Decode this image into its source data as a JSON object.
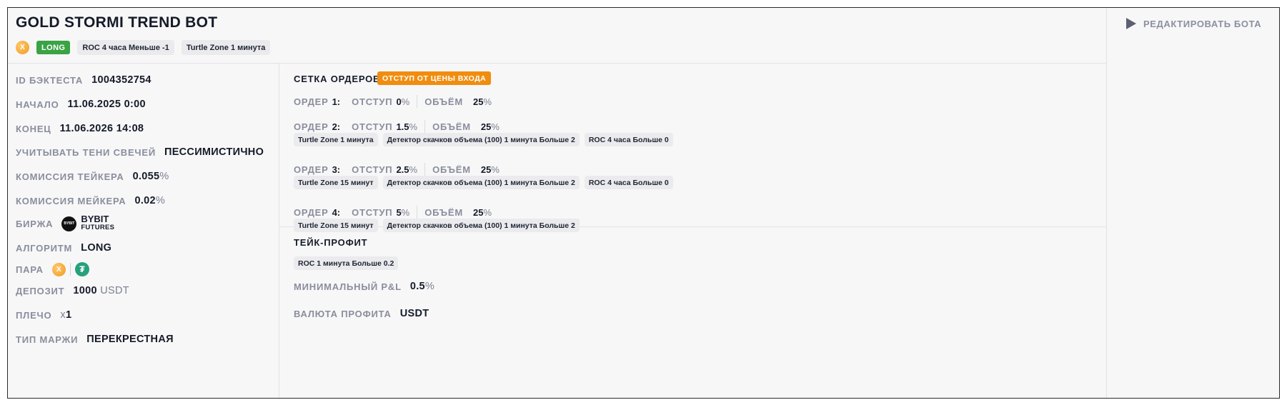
{
  "bot": {
    "title": "GOLD STORMI TREND BOT",
    "coin_symbol": "X",
    "direction_badge": "LONG",
    "tags": [
      "ROC 4 часа Меньше -1",
      "Turtle Zone 1 минута"
    ]
  },
  "edit_button_label": "РЕДАКТИРОВАТЬ БОТА",
  "params": {
    "id": {
      "label": "ID БЭКТЕСТА",
      "value": "1004352754"
    },
    "start": {
      "label": "НАЧАЛО",
      "value": "11.06.2025 0:00"
    },
    "end": {
      "label": "КОНЕЦ",
      "value": "11.06.2026 14:08"
    },
    "shadows": {
      "label": "УЧИТЫВАТЬ ТЕНИ СВЕЧЕЙ",
      "value": "ПЕССИМИСТИЧНО"
    },
    "taker": {
      "label": "КОМИССИЯ ТЕЙКЕРА",
      "value": "0.055",
      "unit": "%"
    },
    "maker": {
      "label": "КОМИССИЯ МЕЙКЕРА",
      "value": "0.02",
      "unit": "%"
    },
    "exchange": {
      "label": "БИРЖА",
      "logo_text": "BYBIT",
      "name": "BYBIT",
      "sub": "FUTURES"
    },
    "algorithm": {
      "label": "АЛГОРИТМ",
      "value": "LONG"
    },
    "pair": {
      "label": "ПАРА",
      "base_symbol": "X",
      "quote_symbol": "₮"
    },
    "deposit": {
      "label": "ДЕПОЗИТ",
      "value": "1000",
      "unit": "USDT"
    },
    "leverage": {
      "label": "ПЛЕЧО",
      "prefix": "x",
      "value": "1"
    },
    "margin": {
      "label": "ТИП МАРЖИ",
      "value": "ПЕРЕКРЕСТНАЯ"
    }
  },
  "orders_grid": {
    "title": "СЕТКА ОРДЕРОВ",
    "badge": "ОТСТУП ОТ ЦЕНЫ ВХОДА",
    "order_label": "ОРДЕР",
    "offset_label": "ОТСТУП",
    "volume_label": "ОБЪЁМ",
    "orders": [
      {
        "num": "1:",
        "offset": "0",
        "volume": "25",
        "conditions": []
      },
      {
        "num": "2:",
        "offset": "1.5",
        "volume": "25",
        "conditions": [
          "Turtle Zone 1 минута",
          "Детектор скачков объема (100) 1 минута Больше 2",
          "ROC 4 часа Больше 0"
        ]
      },
      {
        "num": "3:",
        "offset": "2.5",
        "volume": "25",
        "conditions": [
          "Turtle Zone 15 минут",
          "Детектор скачков объема (100) 1 минута Больше 2",
          "ROC 4 часа Больше 0"
        ]
      },
      {
        "num": "4:",
        "offset": "5",
        "volume": "25",
        "conditions": [
          "Turtle Zone 15 минут",
          "Детектор скачков объема (100) 1 минута Больше 2"
        ]
      }
    ],
    "pct": "%"
  },
  "take_profit": {
    "title": "ТЕЙК-ПРОФИТ",
    "condition": "ROC 1 минута Больше 0.2",
    "min_pnl": {
      "label": "МИНИМАЛЬНЫЙ P&L",
      "value": "0.5",
      "unit": "%"
    },
    "currency": {
      "label": "ВАЛЮТА ПРОФИТА",
      "value": "USDT"
    }
  }
}
